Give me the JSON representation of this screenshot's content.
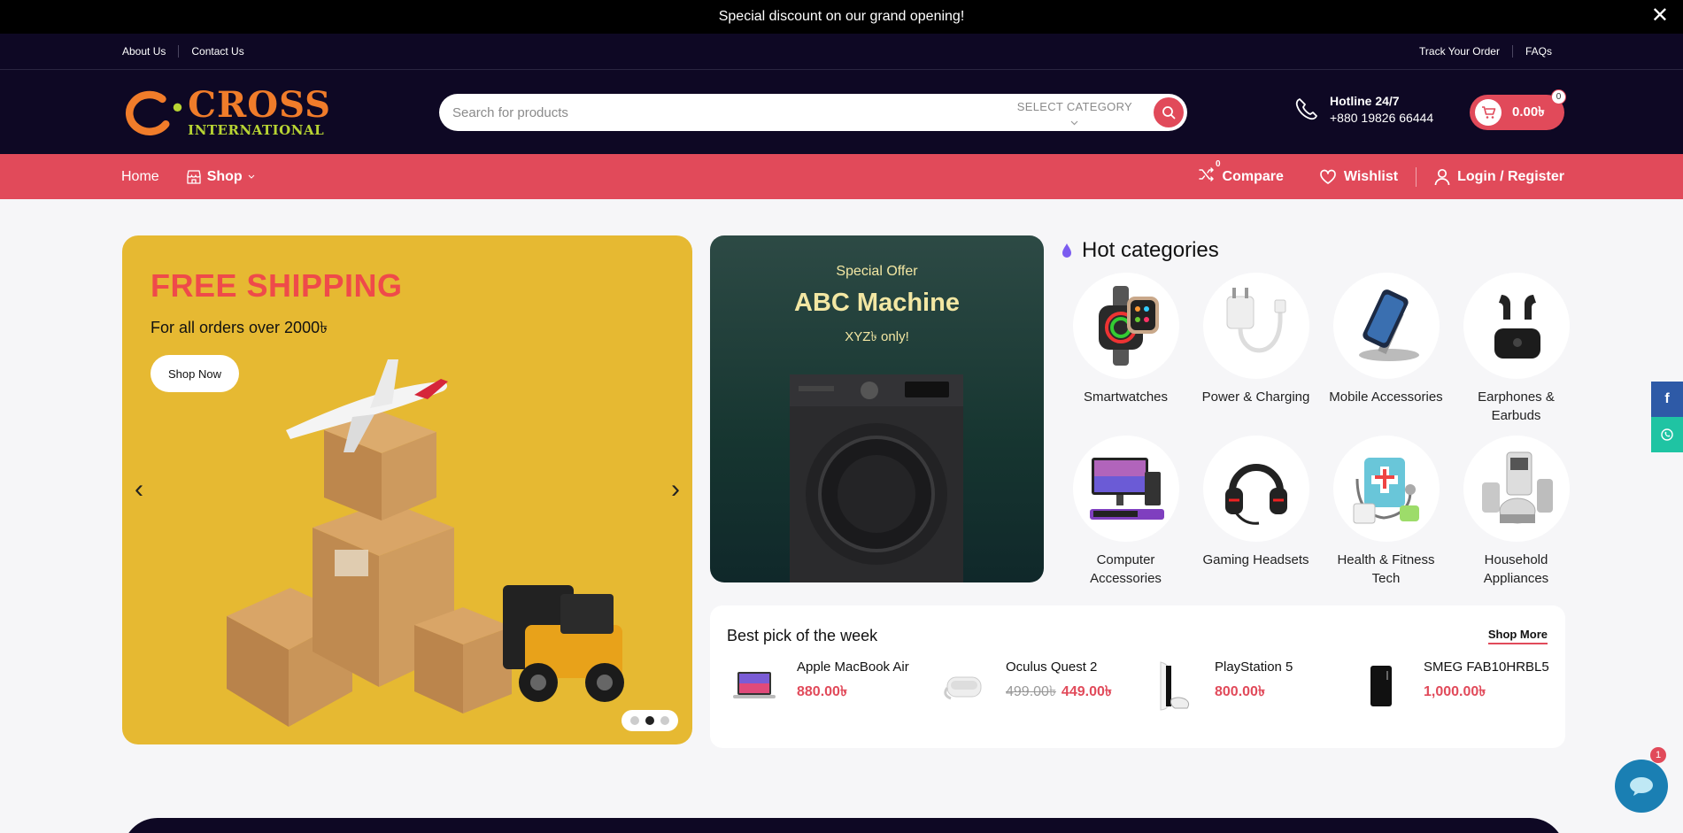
{
  "announcement": {
    "text": "Special discount on our grand opening!",
    "close": "✕"
  },
  "toplinks": {
    "left": [
      "About Us",
      "Contact Us"
    ],
    "right": [
      "Track Your Order",
      "FAQs"
    ]
  },
  "logo": {
    "line1": "CROSS",
    "line2": "INTERNATIONAL"
  },
  "search": {
    "placeholder": "Search for products",
    "category": "SELECT CATEGORY"
  },
  "hotline": {
    "title": "Hotline 24/7",
    "number": "+880 19826 66444"
  },
  "cart": {
    "total": "0.00৳",
    "count": "0"
  },
  "nav": {
    "home": "Home",
    "shop": "Shop",
    "compare": "Compare",
    "compare_count": "0",
    "wishlist": "Wishlist",
    "login": "Login / Register"
  },
  "hero": {
    "title": "FREE SHIPPING",
    "subtitle": "For all orders over 2000৳",
    "button": "Shop Now",
    "prev": "‹",
    "next": "›",
    "slides": 3,
    "active_slide": 2
  },
  "offer": {
    "label": "Special Offer",
    "title": "ABC Machine",
    "price": "XYZ৳ only!"
  },
  "hot": {
    "title": "Hot categories",
    "categories": [
      {
        "name": "Smartwatches",
        "icon": "smartwatch-icon"
      },
      {
        "name": "Power & Charging",
        "icon": "charger-icon"
      },
      {
        "name": "Mobile Accessories",
        "icon": "phone-stand-icon"
      },
      {
        "name": "Earphones & Earbuds",
        "icon": "earbuds-icon"
      },
      {
        "name": "Computer Accessories",
        "icon": "computer-icon"
      },
      {
        "name": "Gaming Headsets",
        "icon": "headset-icon"
      },
      {
        "name": "Health & Fitness Tech",
        "icon": "health-icon"
      },
      {
        "name": "Household Appliances",
        "icon": "appliance-icon"
      }
    ]
  },
  "best": {
    "title": "Best pick of the week",
    "more": "Shop More",
    "items": [
      {
        "name": "Apple MacBook Air",
        "price": "880.00৳",
        "old_price": ""
      },
      {
        "name": "Oculus Quest 2",
        "price": "449.00৳",
        "old_price": "499.00৳"
      },
      {
        "name": "PlayStation 5",
        "price": "800.00৳",
        "old_price": ""
      },
      {
        "name": "SMEG FAB10HRBL5",
        "price": "1,000.00৳",
        "old_price": ""
      }
    ]
  },
  "chat": {
    "badge": "1"
  },
  "colors": {
    "accent": "#e14a5a",
    "navy": "#0e0824",
    "hero_bg": "#e6b932",
    "offer_bg": "#1f3c38"
  }
}
